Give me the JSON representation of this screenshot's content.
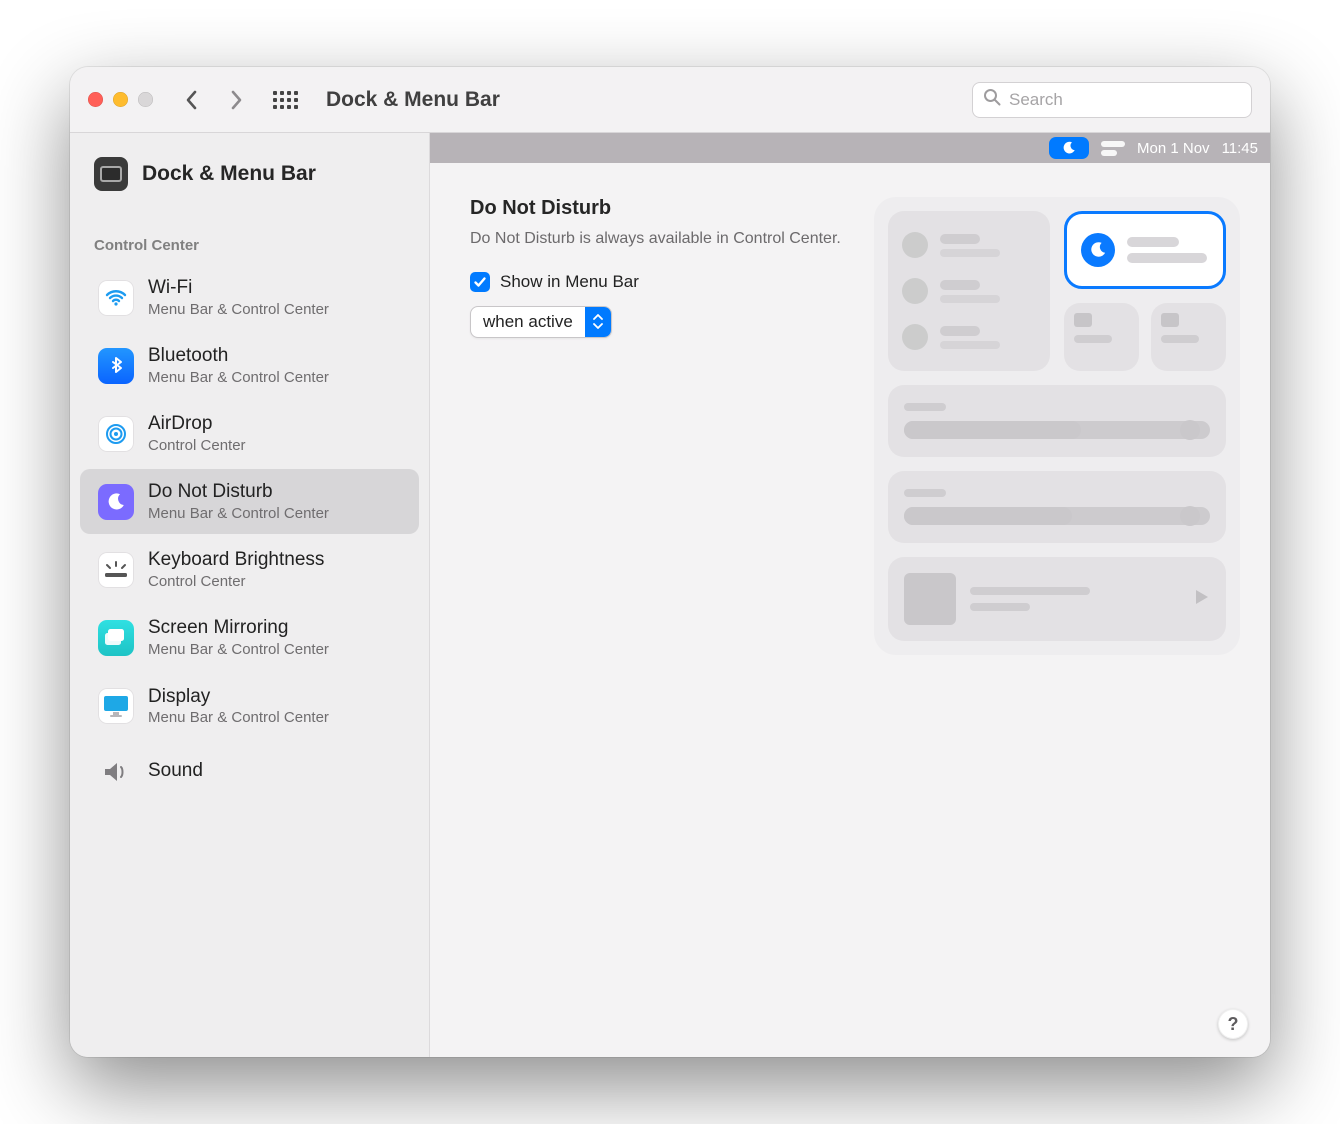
{
  "window": {
    "title": "Dock & Menu Bar",
    "search_placeholder": "Search"
  },
  "sidebar": {
    "top_label": "Dock & Menu Bar",
    "group_label": "Control Center",
    "items": [
      {
        "name": "Wi-Fi",
        "sub": "Menu Bar & Control Center",
        "key": "wifi"
      },
      {
        "name": "Bluetooth",
        "sub": "Menu Bar & Control Center",
        "key": "bluetooth"
      },
      {
        "name": "AirDrop",
        "sub": "Control Center",
        "key": "airdrop"
      },
      {
        "name": "Do Not Disturb",
        "sub": "Menu Bar & Control Center",
        "key": "dnd",
        "selected": true
      },
      {
        "name": "Keyboard Brightness",
        "sub": "Control Center",
        "key": "keyboard-brightness"
      },
      {
        "name": "Screen Mirroring",
        "sub": "Menu Bar & Control Center",
        "key": "screen-mirroring"
      },
      {
        "name": "Display",
        "sub": "Menu Bar & Control Center",
        "key": "display"
      },
      {
        "name": "Sound",
        "sub": "",
        "key": "sound"
      }
    ]
  },
  "menubar": {
    "date": "Mon 1 Nov",
    "time": "11:45"
  },
  "detail": {
    "title": "Do Not Disturb",
    "description": "Do Not Disturb is always available in Control Center.",
    "show_label": "Show in Menu Bar",
    "show_checked": true,
    "dropdown_value": "when active"
  },
  "help": {
    "label": "?"
  }
}
